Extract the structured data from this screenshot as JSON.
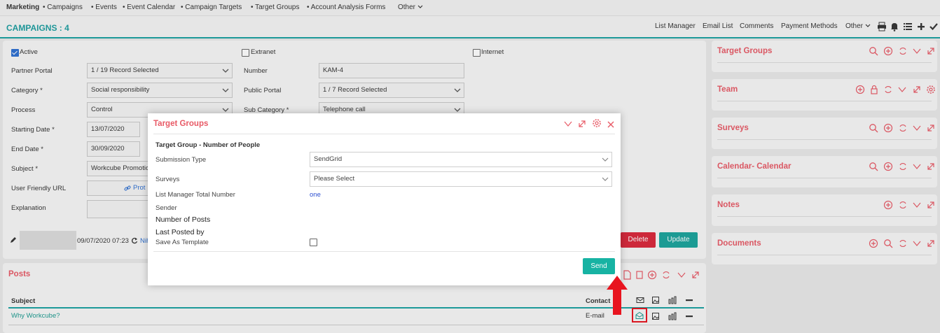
{
  "nav": {
    "items": [
      "Marketing",
      "• Campaigns",
      "• Events",
      "• Event Calendar",
      "• Campaign Targets",
      "• Target Groups",
      "• Account Analysis Forms",
      "Other"
    ]
  },
  "titlebar": {
    "title": "CAMPAIGNS : 4",
    "links": [
      "List Manager",
      "Email List",
      "Comments",
      "Payment Methods",
      "Other"
    ]
  },
  "form": {
    "active_label": "Active",
    "extranet_label": "Extranet",
    "internet_label": "Internet",
    "partner_portal_label": "Partner Portal",
    "partner_portal_value": "1 / 19 Record Selected",
    "number_label": "Number",
    "number_value": "KAM-4",
    "category_label": "Category *",
    "category_value": "Social responsibility",
    "public_portal_label": "Public Portal",
    "public_portal_value": "1 / 7 Record Selected",
    "process_label": "Process",
    "process_value": "Control",
    "subcategory_label": "Sub Category *",
    "subcategory_value": "Telephone call",
    "starting_date_label": "Starting Date *",
    "starting_date_value": "13/07/2020",
    "end_date_label": "End Date *",
    "end_date_value": "30/09/2020",
    "subject_label": "Subject *",
    "subject_value": "Workcube Promotio",
    "url_label": "User Friendly URL",
    "url_value": "Prot",
    "explanation_label": "Explanation",
    "record_date": "09/07/2020 07:23",
    "record_user": "Nih",
    "delete_label": "Delete",
    "update_label": "Update"
  },
  "posts": {
    "title": "Posts",
    "col_subject": "Subject",
    "col_contact": "Contact",
    "row_subject": "Why Workcube?",
    "row_contact": "E-mail"
  },
  "right_panels": [
    "Target Groups",
    "Team",
    "Surveys",
    "Calendar- Calendar",
    "Notes",
    "Documents"
  ],
  "modal": {
    "title": "Target Groups",
    "section": "Target Group - Number of People",
    "submission_type_label": "Submission Type",
    "submission_type_value": "SendGrid",
    "surveys_label": "Surveys",
    "surveys_value": "Please Select",
    "list_total_label": "List Manager Total Number",
    "list_total_value": "one",
    "sender_label": "Sender",
    "num_posts_label": "Number of Posts",
    "last_posted_label": "Last Posted by",
    "save_template_label": "Save As Template",
    "send_label": "Send"
  },
  "colors": {
    "accent": "#1aa1a1",
    "red_title": "#e85a66",
    "send_button": "#17b3a3",
    "delete_button": "#d9263a",
    "arrow": "#e8141f"
  }
}
